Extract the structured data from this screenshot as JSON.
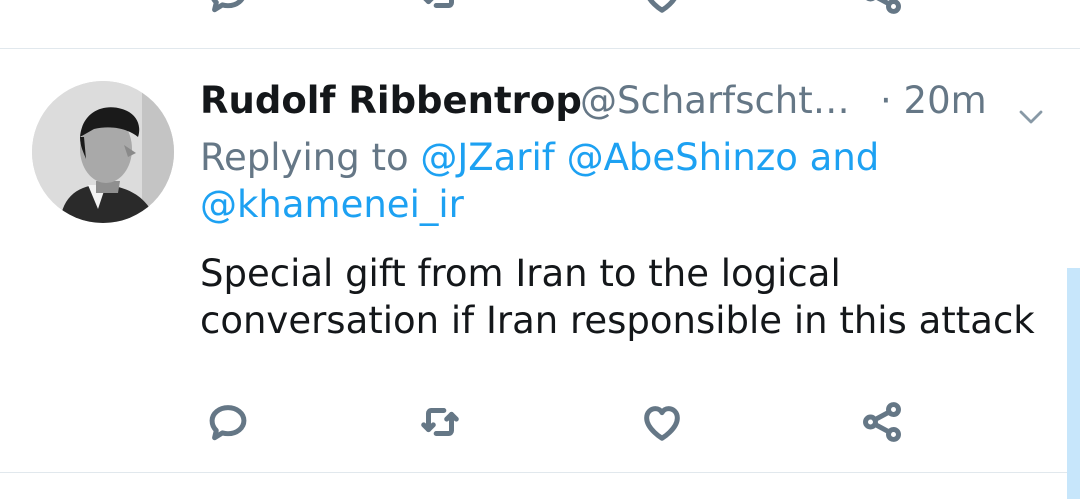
{
  "tweet": {
    "display_name": "Rudolf Ribbentrop",
    "handle": "@Scharfscht…",
    "timestamp": "· 20m",
    "replying_to_label": "Replying to",
    "mentions": [
      "@JZarif",
      "@AbeShinzo",
      "@khamenei_ir"
    ],
    "mention_joiner": "and",
    "text_line_1": "Special gift from Iran to the logical",
    "text_line_2": "conversation if Iran responsible in this attack"
  },
  "icons": {
    "reply": "reply-icon",
    "retweet": "retweet-icon",
    "like": "heart-icon",
    "share": "share-icon",
    "menu": "chevron-down-icon"
  },
  "colors": {
    "text": "#14171a",
    "secondary": "#657786",
    "link": "#1da1f2",
    "divider": "#e1e8ed",
    "scrollbar": "#c7e6fb"
  }
}
